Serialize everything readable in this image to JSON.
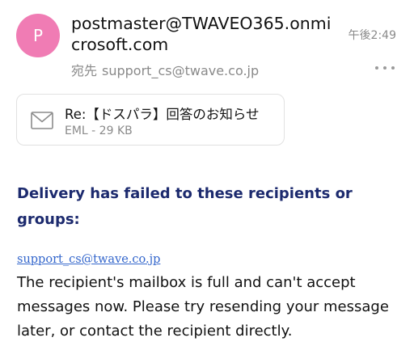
{
  "email": {
    "avatar_letter": "P",
    "sender": "postmaster@TWAVEO365.onmicrosoft.com",
    "time": "午後2:49",
    "to_label": "宛先",
    "to_address": "support_cs@twave.co.jp"
  },
  "attachment": {
    "icon": "envelope-icon",
    "name": "Re:【ドスパラ】回答のお知らせ",
    "meta": "EML - 29 KB"
  },
  "body": {
    "headline": "Delivery has failed to these recipients or groups:",
    "recipient_link": "support_cs@twave.co.jp",
    "message": "The recipient's mailbox is full and can't accept messages now. Please try resending your message later, or contact the recipient directly."
  },
  "colors": {
    "avatar": "#f07cb4",
    "headline": "#1c2a6e",
    "link": "#3366cc",
    "muted": "#8a8a8a"
  }
}
